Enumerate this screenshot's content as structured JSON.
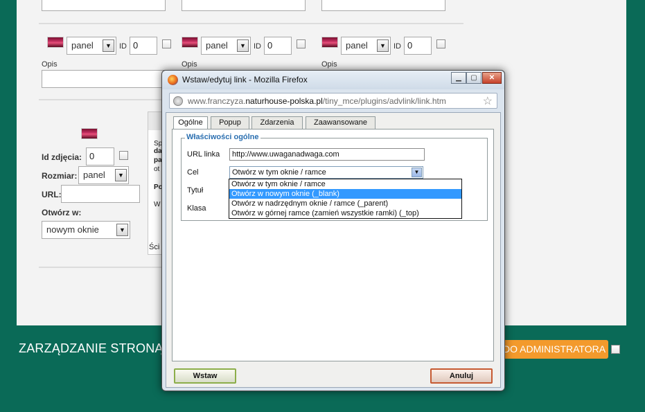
{
  "page": {
    "panel_group": [
      {
        "select_value": "panel",
        "id_label": "ID",
        "id_value": "0",
        "desc_label": "Opis"
      },
      {
        "select_value": "panel",
        "id_label": "ID",
        "id_value": "0",
        "desc_label": "Opis"
      },
      {
        "select_value": "panel",
        "id_label": "ID",
        "id_value": "0",
        "desc_label": "Opis"
      }
    ],
    "photo_form": {
      "id_label": "Id zdjęcia:",
      "id_value": "0",
      "size_label": "Rozmiar:",
      "size_value": "panel",
      "url_label": "URL:",
      "url_value": "",
      "open_in_label": "Otwórz w:",
      "open_in_value": "nowym oknie"
    },
    "partial_text": {
      "line1": "Sp",
      "line2": "da",
      "line3": "pa",
      "line4": "ot",
      "line5": "Po",
      "line6": "W",
      "bottom": "Ści"
    },
    "footer": {
      "title": "ZARZĄDZANIE STRONĄ",
      "admin_button": "DO ADMINISTRATORA"
    },
    "colors": {
      "background": "#0a6a57",
      "admin_button": "#f39a2c",
      "highlight": "#3399ff"
    }
  },
  "dialog": {
    "window_title": "Wstaw/edytuj link - Mozilla Firefox",
    "url_host_prefix": "www.franczyza.",
    "url_host_main": "naturhouse-polska.pl",
    "url_path": "/tiny_mce/plugins/advlink/link.htm",
    "tabs": [
      "Ogólne",
      "Popup",
      "Zdarzenia",
      "Zaawansowane"
    ],
    "legend": "Właściwości ogólne",
    "url_label": "URL linka",
    "url_value": "http://www.uwaganadwaga.com",
    "target_label": "Cel",
    "target_value": "Otwórz w tym oknie / ramce",
    "title_label": "Tytuł",
    "class_label": "Klasa",
    "target_options": [
      "Otwórz w tym oknie / ramce",
      "Otwórz w nowym oknie (_blank)",
      "Otwórz w nadrzędnym oknie / ramce (_parent)",
      "Otwórz w górnej ramce (zamień wszystkie ramki) (_top)"
    ],
    "insert_button": "Wstaw",
    "cancel_button": "Anuluj"
  }
}
